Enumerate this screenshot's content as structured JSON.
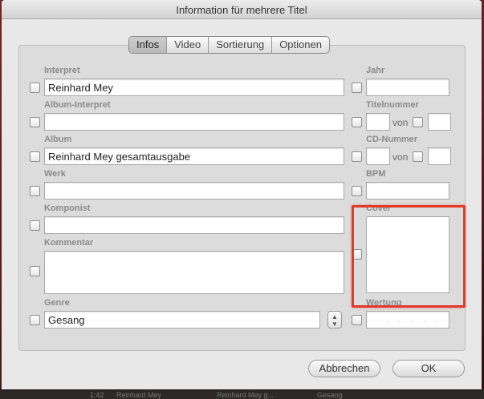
{
  "window": {
    "title": "Information für mehrere Titel"
  },
  "tabs": [
    "Infos",
    "Video",
    "Sortierung",
    "Optionen"
  ],
  "fields": {
    "interpret": {
      "label": "Interpret",
      "value": "Reinhard Mey"
    },
    "album_interpret": {
      "label": "Album-Interpret",
      "value": ""
    },
    "album": {
      "label": "Album",
      "value": "Reinhard Mey gesamtausgabe"
    },
    "werk": {
      "label": "Werk",
      "value": ""
    },
    "komponist": {
      "label": "Komponist",
      "value": ""
    },
    "kommentar": {
      "label": "Kommentar",
      "value": ""
    },
    "genre": {
      "label": "Genre",
      "value": "Gesang"
    },
    "jahr": {
      "label": "Jahr",
      "value": ""
    },
    "titelnummer": {
      "label": "Titelnummer",
      "value": "",
      "von_label": "von",
      "von_value": ""
    },
    "cd_nummer": {
      "label": "CD-Nummer",
      "value": "",
      "von_label": "von",
      "von_value": ""
    },
    "bpm": {
      "label": "BPM",
      "value": ""
    },
    "cover": {
      "label": "Cover"
    },
    "wertung": {
      "label": "Wertung",
      "dots": "· · · · ·"
    }
  },
  "buttons": {
    "cancel": "Abbrechen",
    "ok": "OK"
  },
  "background_list": {
    "time": "1:42",
    "artist": "Reinhard Mey",
    "album": "Reinhard Mey g...",
    "genre": "Gesang"
  },
  "colors": {
    "highlight": "#e23a2a",
    "background_window": "#8b2a2a"
  }
}
